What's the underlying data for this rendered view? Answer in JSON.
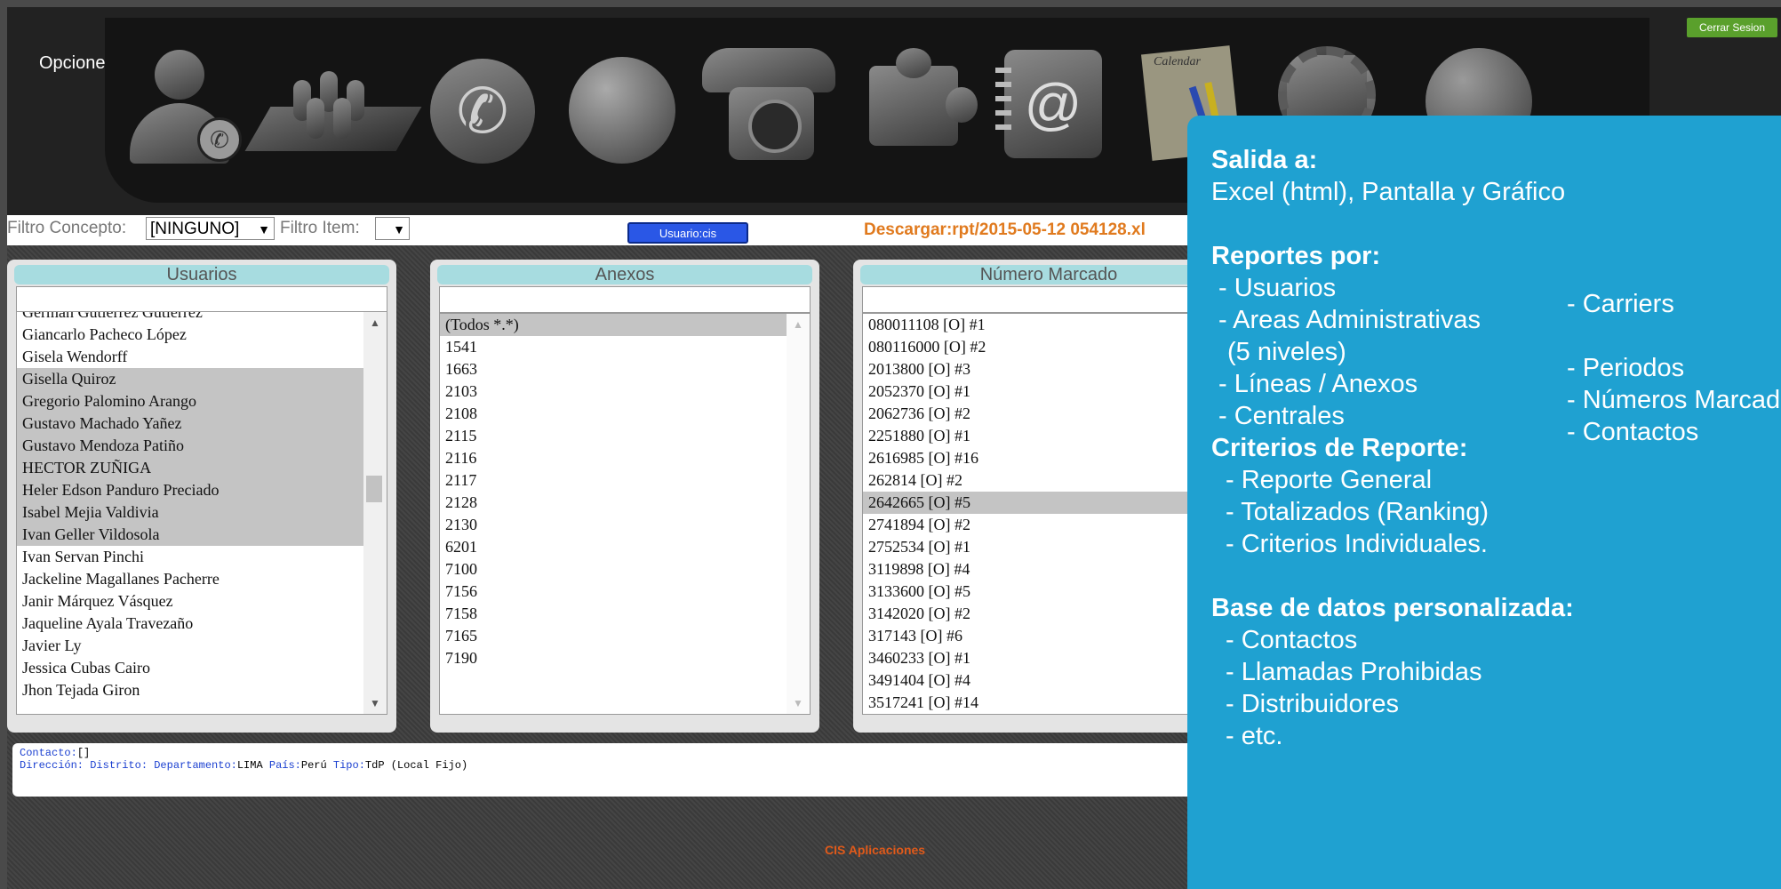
{
  "header": {
    "options_label": "Opciones",
    "logout_label": "Cerrar Sesion",
    "menu_icons": [
      "user-phone-icon",
      "areas-icon",
      "phone-icon",
      "network-globe-icon",
      "old-telephone-icon",
      "puzzle-icon",
      "address-book-icon",
      "calendar-icon",
      "settings-gear-icon",
      "earth-globe-icon"
    ]
  },
  "filters": {
    "concept_label": "Filtro Concepto:",
    "concept_value": "[NINGUNO]",
    "item_label": "Filtro Item:",
    "item_value": "",
    "user_button": "Usuario:cis",
    "download_text": "Descargar:rpt/2015-05-12 054128.xl"
  },
  "panels": {
    "usuarios": {
      "title": "Usuarios",
      "items": [
        {
          "label": "German Gutierrez Gutierrez",
          "selected": false
        },
        {
          "label": "Giancarlo Pacheco López",
          "selected": false
        },
        {
          "label": "Gisela Wendorff",
          "selected": false
        },
        {
          "label": "Gisella Quiroz",
          "selected": true
        },
        {
          "label": "Gregorio Palomino Arango",
          "selected": true
        },
        {
          "label": "Gustavo Machado Yañez",
          "selected": true
        },
        {
          "label": "Gustavo Mendoza Patiño",
          "selected": true
        },
        {
          "label": "HECTOR ZUÑIGA",
          "selected": true
        },
        {
          "label": "Heler Edson Panduro Preciado",
          "selected": true
        },
        {
          "label": "Isabel Mejia Valdivia",
          "selected": true
        },
        {
          "label": "Ivan Geller Vildosola",
          "selected": true
        },
        {
          "label": "Ivan Servan Pinchi",
          "selected": false
        },
        {
          "label": "Jackeline Magallanes Pacherre",
          "selected": false
        },
        {
          "label": "Janir Márquez Vásquez",
          "selected": false
        },
        {
          "label": "Jaqueline Ayala Travezaño",
          "selected": false
        },
        {
          "label": "Javier Ly",
          "selected": false
        },
        {
          "label": "Jessica Cubas Cairo",
          "selected": false
        },
        {
          "label": "Jhon Tejada Giron",
          "selected": false
        }
      ]
    },
    "anexos": {
      "title": "Anexos",
      "items": [
        {
          "label": "(Todos *.*)",
          "selected": true
        },
        {
          "label": "1541",
          "selected": false
        },
        {
          "label": "1663",
          "selected": false
        },
        {
          "label": "2103",
          "selected": false
        },
        {
          "label": "2108",
          "selected": false
        },
        {
          "label": "2115",
          "selected": false
        },
        {
          "label": "2116",
          "selected": false
        },
        {
          "label": "2117",
          "selected": false
        },
        {
          "label": "2128",
          "selected": false
        },
        {
          "label": "2130",
          "selected": false
        },
        {
          "label": "6201",
          "selected": false
        },
        {
          "label": "7100",
          "selected": false
        },
        {
          "label": "7156",
          "selected": false
        },
        {
          "label": "7158",
          "selected": false
        },
        {
          "label": "7165",
          "selected": false
        },
        {
          "label": "7190",
          "selected": false
        }
      ]
    },
    "numero": {
      "title": "Número Marcado",
      "items": [
        {
          "label": "080011108 [O] #1",
          "selected": false
        },
        {
          "label": "080116000 [O] #2",
          "selected": false
        },
        {
          "label": "2013800 [O] #3",
          "selected": false
        },
        {
          "label": "2052370 [O] #1",
          "selected": false
        },
        {
          "label": "2062736 [O] #2",
          "selected": false
        },
        {
          "label": "2251880 [O] #1",
          "selected": false
        },
        {
          "label": "2616985 [O] #16",
          "selected": false
        },
        {
          "label": "262814 [O] #2",
          "selected": false
        },
        {
          "label": "2642665 [O] #5",
          "selected": true
        },
        {
          "label": "2741894 [O] #2",
          "selected": false
        },
        {
          "label": "2752534 [O] #1",
          "selected": false
        },
        {
          "label": "3119898 [O] #4",
          "selected": false
        },
        {
          "label": "3133600 [O] #5",
          "selected": false
        },
        {
          "label": "3142020 [O] #2",
          "selected": false
        },
        {
          "label": "317143 [O] #6",
          "selected": false
        },
        {
          "label": "3460233 [O] #1",
          "selected": false
        },
        {
          "label": "3491404 [O] #4",
          "selected": false
        },
        {
          "label": "3517241 [O] #14",
          "selected": false
        }
      ]
    }
  },
  "details": {
    "contacto_label": "Contacto:",
    "contacto_value": "[]",
    "direccion_label": "Dirección:",
    "distrito_label": "Distrito:",
    "departamento_label": "Departamento:",
    "departamento_value": "LIMA",
    "pais_label": "País:",
    "pais_value": "Perú",
    "tipo_label": "Tipo:",
    "tipo_value": "TdP (Local Fijo)"
  },
  "footer": {
    "text": "CIS Aplicaciones"
  },
  "info": {
    "salida_title": "Salida a:",
    "salida_text": "Excel (html), Pantalla y Gráfico",
    "reportes_title": "Reportes por:",
    "reportes_left": [
      "- Usuarios",
      "- Areas Administrativas",
      "(5 niveles)",
      "- Líneas / Anexos",
      "- Centrales"
    ],
    "reportes_right": [
      "- Carriers",
      "- Periodos",
      "- Números Marcados",
      "- Contactos"
    ],
    "criterios_title": "Criterios de Reporte:",
    "criterios": [
      "- Reporte General",
      "- Totalizados (Ranking)",
      "- Criterios Individuales."
    ],
    "base_title": "Base de datos personalizada:",
    "base": [
      "- Contactos",
      "- Llamadas Prohibidas",
      "- Distribuidores",
      "- etc."
    ]
  }
}
